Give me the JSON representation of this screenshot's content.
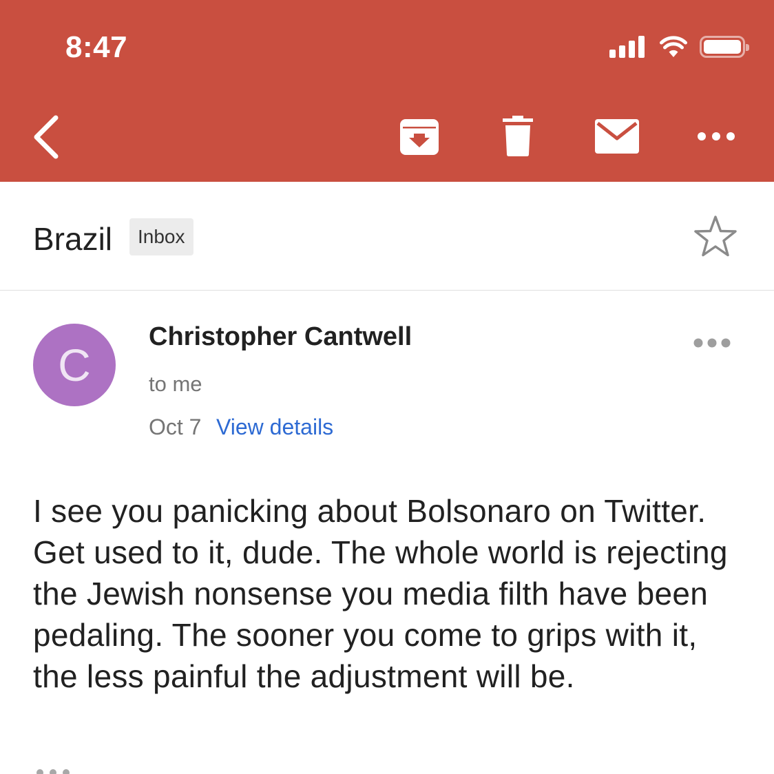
{
  "status_bar": {
    "time": "8:47"
  },
  "toolbar": {
    "back": "back-arrow-icon",
    "archive": "archive-icon",
    "delete": "trash-icon",
    "mark_unread": "mail-icon",
    "more": "more-horizontal-icon"
  },
  "thread": {
    "subject": "Brazil",
    "label": "Inbox",
    "starred": false
  },
  "message": {
    "avatar_letter": "C",
    "avatar_color": "#ad72c3",
    "sender": "Christopher Cantwell",
    "recipient": "to me",
    "date": "Oct 7",
    "details_link": "View details",
    "body": "I see you panicking about Bolsonaro on Twitter. Get used to it, dude. The whole world is rejecting the Jewish nonsense you media filth have been pedaling. The sooner you come to grips with it, the less painful the adjustment will be."
  },
  "colors": {
    "header": "#c94f40",
    "link": "#2d6ad3",
    "label_chip": "#ececec"
  }
}
